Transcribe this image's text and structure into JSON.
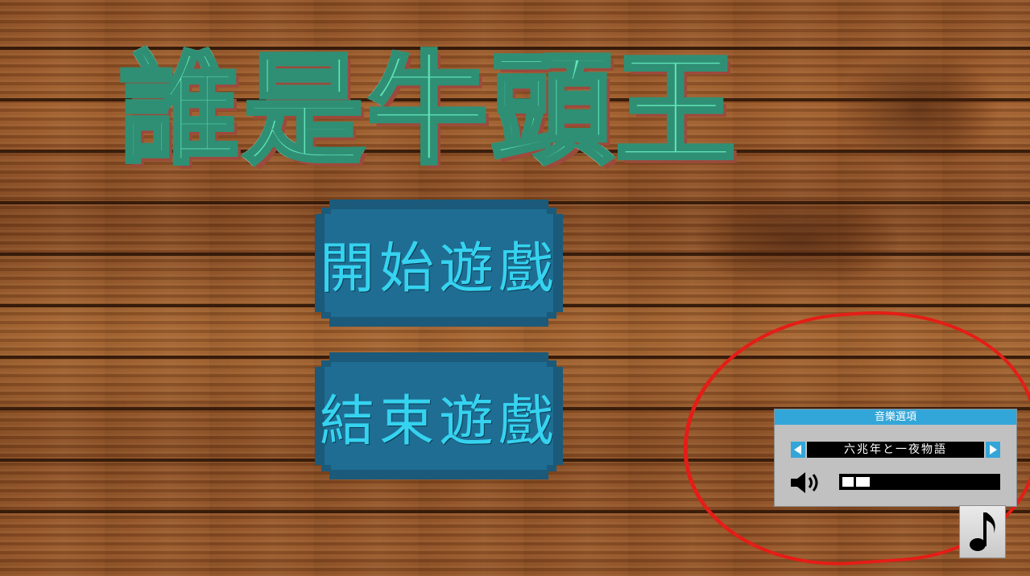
{
  "title": "誰是牛頭王",
  "menu": {
    "start_label": "開始遊戲",
    "quit_label": "結束遊戲"
  },
  "music_panel": {
    "header": "音樂選項",
    "track_name": "六兆年と一夜物語",
    "volume_level": 0.2
  },
  "icons": {
    "prev": "triangle-left-icon",
    "next": "triangle-right-icon",
    "speaker": "speaker-icon",
    "music": "music-note-icon"
  },
  "colors": {
    "title_fill": "#5fe3b8",
    "button_fill": "#1f6d92",
    "button_text": "#35d3f0",
    "panel_header": "#33a6d9",
    "annotation": "#e51d17"
  }
}
